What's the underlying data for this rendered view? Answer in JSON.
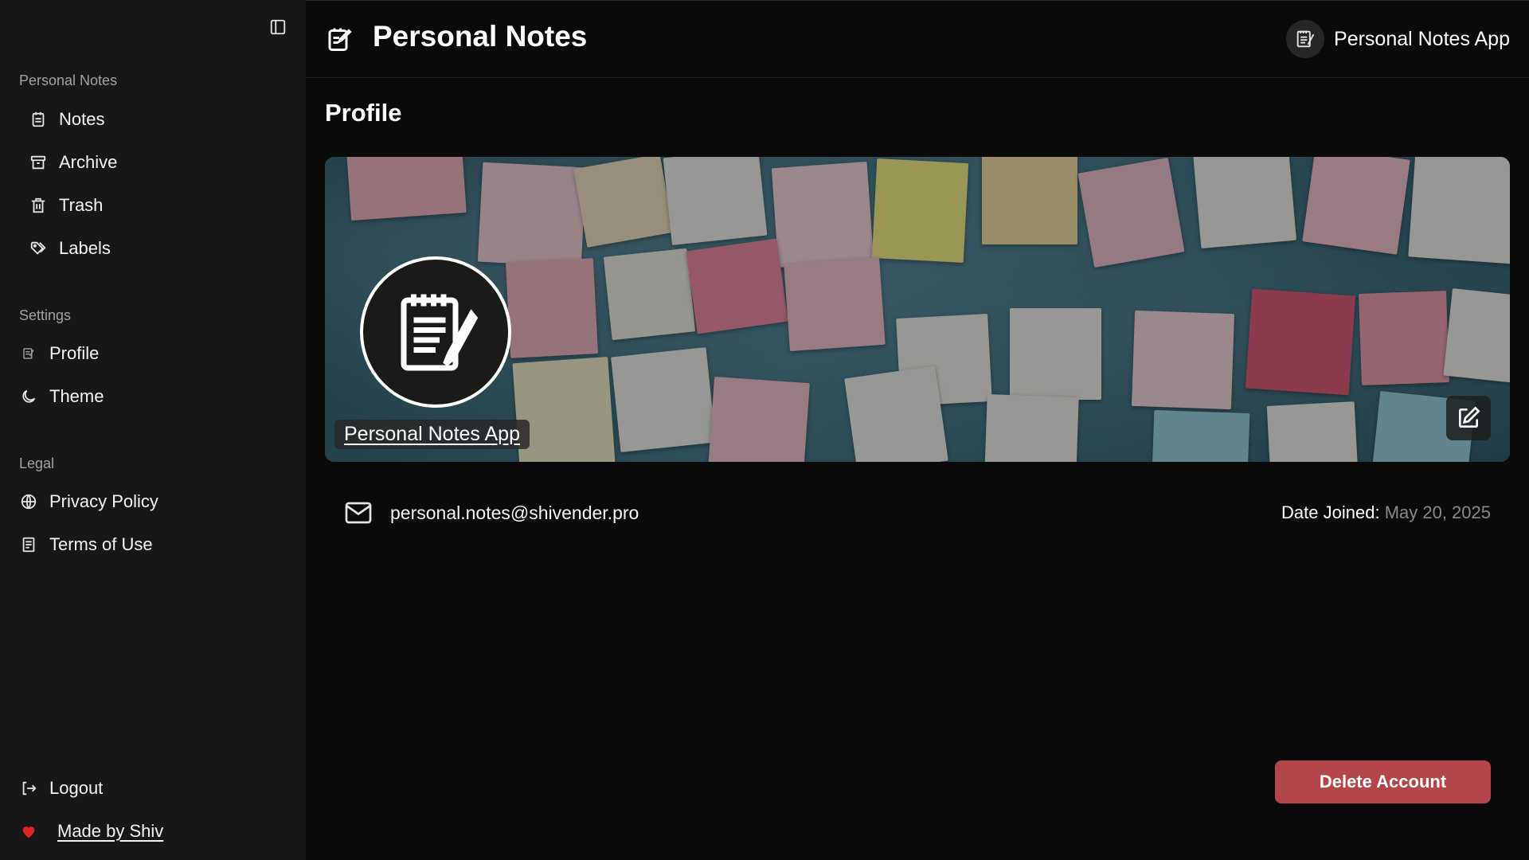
{
  "sidebar": {
    "toggle_icon": "sidebar-panel-icon",
    "groups": {
      "main": "Personal Notes",
      "settings": "Settings",
      "legal": "Legal"
    },
    "items": {
      "notes": "Notes",
      "archive": "Archive",
      "trash": "Trash",
      "labels": "Labels",
      "profile": "Profile",
      "theme": "Theme",
      "privacy": "Privacy Policy",
      "terms": "Terms of Use",
      "logout": "Logout",
      "made_by": "Made by Shiv"
    },
    "heart_color": "#e02424"
  },
  "header": {
    "title": "Personal Notes",
    "app_name": "Personal Notes App"
  },
  "profile": {
    "page_title": "Profile",
    "display_name": "Personal Notes App",
    "email": "personal.notes@shivender.pro",
    "date_label": "Date Joined:",
    "date_value": "May 20, 2025",
    "delete_label": "Delete Account"
  },
  "colors": {
    "background": "#0a0a0a",
    "sidebar": "#171717",
    "danger": "#b4454a"
  }
}
